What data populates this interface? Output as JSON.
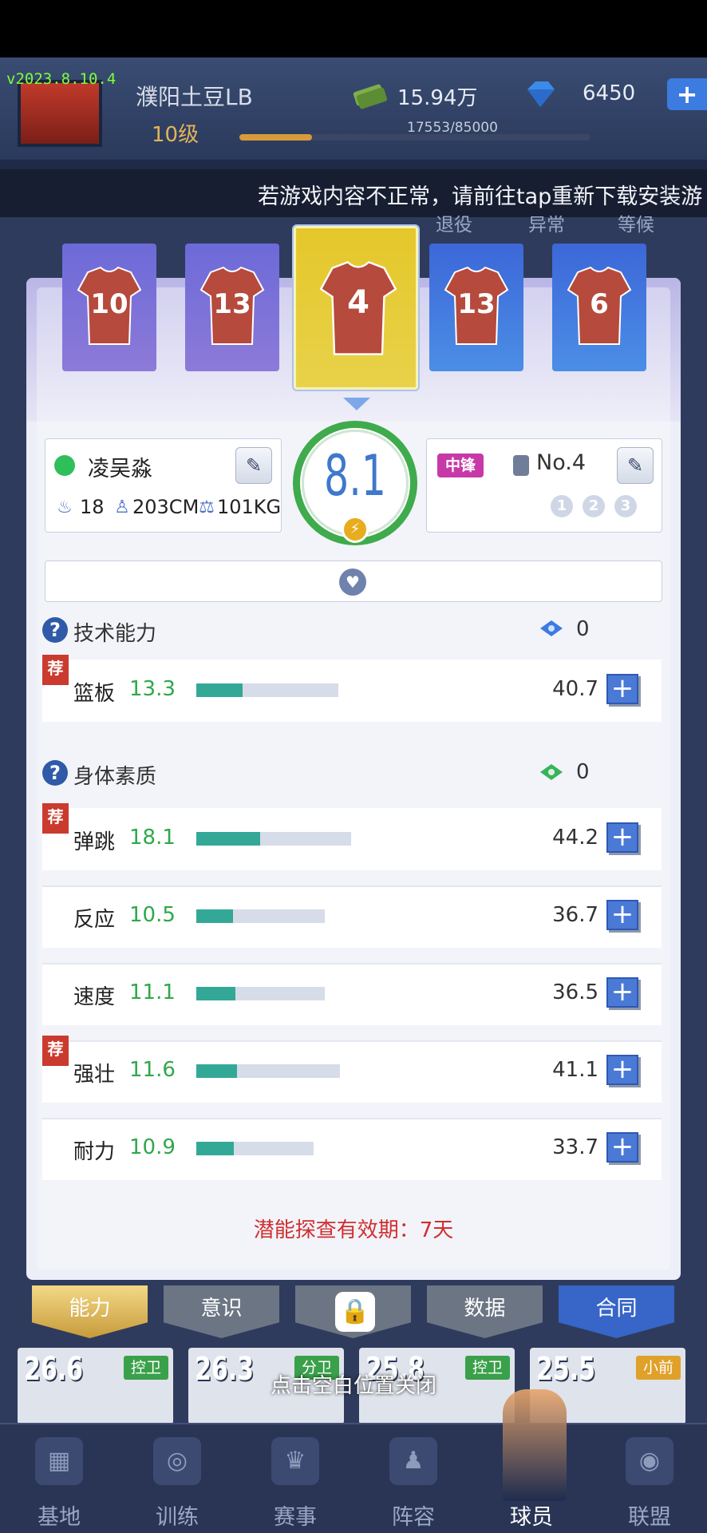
{
  "version": "v2023.8.10.4",
  "header": {
    "player_name": "濮阳土豆LB",
    "level": "10级",
    "xp_text": "17553/85000",
    "xp_progress": 0.2065,
    "money": "15.94万",
    "gems": "6450",
    "add_symbol": "+"
  },
  "marquee": "若游戏内容不正常，请前往tap重新下载安装游",
  "background_tabs": [
    "退役",
    "异常",
    "等候"
  ],
  "cards": [
    {
      "number": "10",
      "style": "purple"
    },
    {
      "number": "13",
      "style": "purple"
    },
    {
      "number": "4",
      "style": "gold"
    },
    {
      "number": "13",
      "style": "blue"
    },
    {
      "number": "6",
      "style": "blue"
    }
  ],
  "player": {
    "name": "凌吴淼",
    "age": "18",
    "height": "203CM",
    "weight": "101KG",
    "rating": "8.1",
    "position": "中锋",
    "jersey": "No.4",
    "slots": [
      "1",
      "2",
      "3"
    ]
  },
  "sections": {
    "technical": {
      "title": "技术能力",
      "points": "0"
    },
    "physical": {
      "title": "身体素质",
      "points": "0"
    }
  },
  "rec_label": "荐",
  "technical_rows": [
    {
      "name": "篮板",
      "value": "13.3",
      "max": "40.7",
      "fill": 0.327,
      "bar_len": 0.81,
      "recommended": true
    }
  ],
  "physical_rows": [
    {
      "name": "弹跳",
      "value": "18.1",
      "max": "44.2",
      "fill": 0.41,
      "bar_len": 0.88,
      "recommended": true
    },
    {
      "name": "反应",
      "value": "10.5",
      "max": "36.7",
      "fill": 0.286,
      "bar_len": 0.73,
      "recommended": false
    },
    {
      "name": "速度",
      "value": "11.1",
      "max": "36.5",
      "fill": 0.304,
      "bar_len": 0.73,
      "recommended": false
    },
    {
      "name": "强壮",
      "value": "11.6",
      "max": "41.1",
      "fill": 0.282,
      "bar_len": 0.82,
      "recommended": true
    },
    {
      "name": "耐力",
      "value": "10.9",
      "max": "33.7",
      "fill": 0.323,
      "bar_len": 0.67,
      "recommended": false
    }
  ],
  "footer_note": "潜能探查有效期：7天",
  "detail_tabs": [
    "能力",
    "意识",
    "",
    "数据",
    "合同"
  ],
  "strip_players": [
    {
      "rating": "26.6",
      "pos": "控卫"
    },
    {
      "rating": "26.3",
      "pos": "分卫"
    },
    {
      "rating": "25.8",
      "pos": "控卫"
    },
    {
      "rating": "25.5",
      "pos": "小前"
    }
  ],
  "close_hint": "点击空白位置关闭",
  "bottom_nav": [
    "基地",
    "训练",
    "赛事",
    "阵容",
    "球员",
    "联盟"
  ]
}
